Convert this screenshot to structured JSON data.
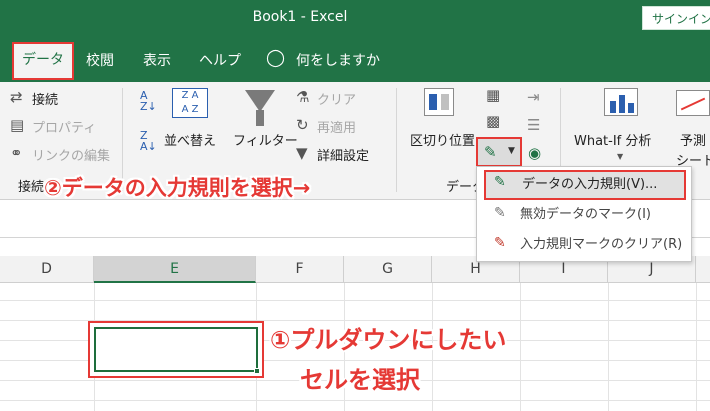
{
  "window": {
    "title": "Book1  -  Excel",
    "signin": "サインイン"
  },
  "tabs": [
    "データ",
    "校閲",
    "表示",
    "ヘルプ"
  ],
  "tell_me": "何をしますか",
  "ribbon": {
    "connections": {
      "connect": "接続",
      "properties": "プロパティ",
      "edit_links": "リンクの編集",
      "group_label": "接続"
    },
    "sort": {
      "sort_label": "並べ替え",
      "az": "A Z",
      "za": "Z A"
    },
    "filter": {
      "filter_label": "フィルター",
      "clear": "クリア",
      "reapply": "再適用",
      "advanced": "詳細設定"
    },
    "data_tools": {
      "text_to_columns": "区切り位置",
      "group_label": "データ"
    },
    "forecast": {
      "whatif": "What-If 分析",
      "forecast_sheet_1": "予測",
      "forecast_sheet_2": "シート"
    }
  },
  "validation_menu": {
    "items": [
      "データの入力規則(V)...",
      "無効データのマーク(I)",
      "入力規則マークのクリア(R)"
    ]
  },
  "grid": {
    "columns": [
      "D",
      "E",
      "F",
      "G",
      "H",
      "I",
      "J"
    ]
  },
  "annotations": {
    "step2": "②データの入力規則を選択→",
    "step1_line1": "①プルダウンにしたい",
    "step1_line2": "セルを選択"
  },
  "colors": {
    "excel_green": "#217346",
    "annotation_red": "#e53935",
    "selection_green": "#1e6e3c"
  }
}
